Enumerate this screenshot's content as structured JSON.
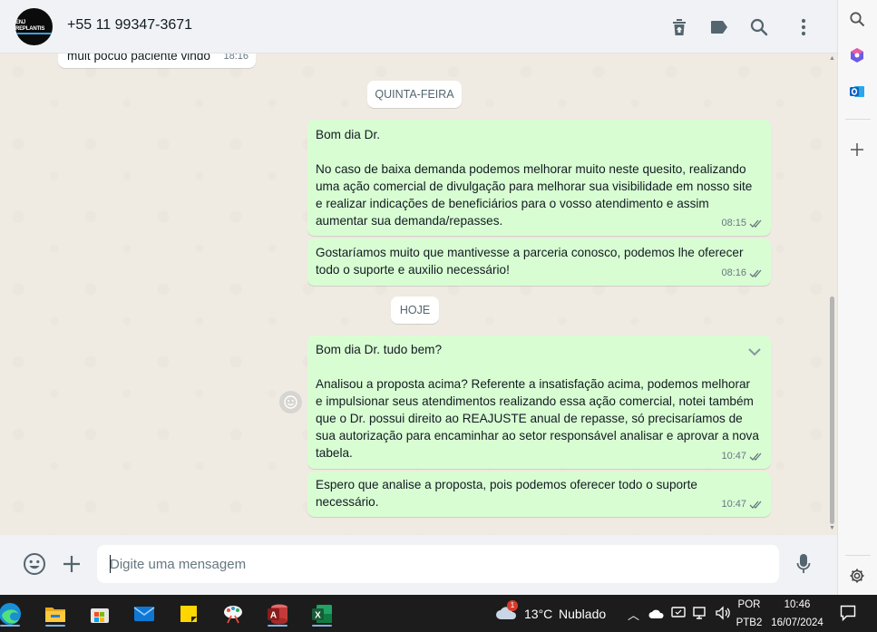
{
  "header": {
    "contact_name": "+55 11 99347-3671",
    "avatar_logo_text": "ENJ REPLANTIS",
    "icons": [
      "delete-icon",
      "label-icon",
      "search-icon",
      "menu-dots-icon"
    ]
  },
  "chat": {
    "partial_message": {
      "text": "muit pocuo paciente vindo",
      "time": "18:16"
    },
    "date_chips": [
      "QUINTA-FEIRA",
      "HOJE"
    ],
    "messages": [
      {
        "text": "Bom dia Dr.\n\nNo caso de baixa demanda podemos melhorar muito neste quesito, realizando uma ação comercial de divulgação para melhorar sua visibilidade em nosso site e realizar indicações de beneficiários para o vosso atendimento e assim aumentar sua demanda/repasses.",
        "time": "08:15"
      },
      {
        "text": "Gostaríamos muito que mantivesse a parceria conosco, podemos lhe oferecer todo o suporte e auxilio necessário!",
        "time": "08:16"
      },
      {
        "text": "Bom dia Dr. tudo bem?\n\nAnalisou a proposta acima? Referente a insatisfação acima, podemos melhorar e impulsionar seus atendimentos realizando essa ação comercial, notei também que o Dr. possui direito ao REAJUSTE anual de repasse, só precisaríamos de sua autorização para encaminhar ao setor responsável analisar e aprovar a nova tabela.",
        "time": "10:47"
      },
      {
        "text": "Espero que analise a proposta, pois podemos oferecer todo o suporte necessário.",
        "time": "10:47"
      }
    ]
  },
  "composer": {
    "placeholder": "Digite uma mensagem",
    "icons": [
      "emoji-icon",
      "attach-plus-icon",
      "microphone-icon"
    ]
  },
  "edge_sidebar": {
    "icons": [
      "search-icon",
      "copilot-icon",
      "outlook-icon",
      "add-icon",
      "settings-icon"
    ]
  },
  "taskbar": {
    "weather_temp": "13°C",
    "weather_text": "Nublado",
    "weather_badge": "1",
    "language_line1": "POR",
    "language_line2": "PTB2",
    "time": "10:46",
    "date": "16/07/2024",
    "apps": [
      "edge-icon",
      "file-explorer-icon",
      "microsoft-store-icon",
      "mail-icon",
      "sticky-notes-icon",
      "snipping-tool-icon",
      "access-icon",
      "excel-icon"
    ],
    "colors": {
      "accent": "#7fb3e6"
    }
  },
  "colors": {
    "outgoing_bubble": "#d9fdd3",
    "chat_background": "#efeae2",
    "header_background": "#f0f2f5",
    "read_ticks": "#667781"
  }
}
